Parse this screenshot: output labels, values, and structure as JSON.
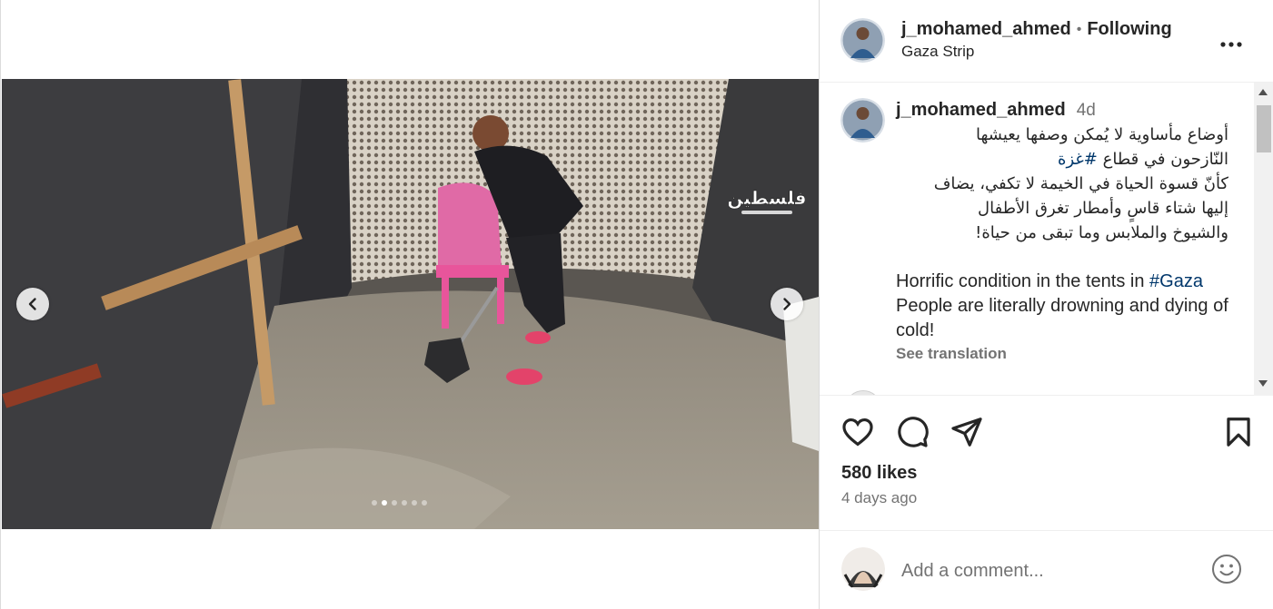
{
  "post": {
    "username": "j_mohamed_ahmed",
    "separator": "•",
    "follow_status": "Following",
    "location": "Gaza Strip",
    "more_icon": "more-horizontal-icon"
  },
  "media": {
    "watermark_text": "فلسطين",
    "carousel": {
      "total_slides": 6,
      "active_slide": 2
    },
    "prev_icon": "chevron-left-icon",
    "next_icon": "chevron-right-icon"
  },
  "caption": {
    "username": "j_mohamed_ahmed",
    "time_ago": "4d",
    "arabic_line_1": "أوضاع مأساوية لا يُمكن وصفها يعيشها",
    "arabic_line_2_text": "النّازحون في قطاع",
    "arabic_line_2_tag": "#غزة",
    "arabic_line_3": "كأنّ قسوة الحياة في الخيمة لا تكفي، يضاف",
    "arabic_line_4": "إليها شتاء قاسٍ وأمطار تغرق الأطفال",
    "arabic_line_5": "والشيوخ والملابس وما تبقى من حياة!",
    "english_text_1": "Horrific condition in the tents in",
    "english_tag": "#Gaza",
    "english_text_2": "People are literally drowning and dying of cold!",
    "see_translation": "See translation"
  },
  "actions": {
    "like_icon": "heart-icon",
    "comment_icon": "comment-icon",
    "share_icon": "send-icon",
    "save_icon": "bookmark-icon"
  },
  "stats": {
    "likes": "580 likes",
    "date": "4 days ago"
  },
  "add_comment": {
    "placeholder": "Add a comment...",
    "emoji_icon": "emoji-icon"
  },
  "colors": {
    "text": "#262626",
    "secondary": "#737373",
    "hashtag": "#00376b",
    "divider": "#efefef"
  }
}
